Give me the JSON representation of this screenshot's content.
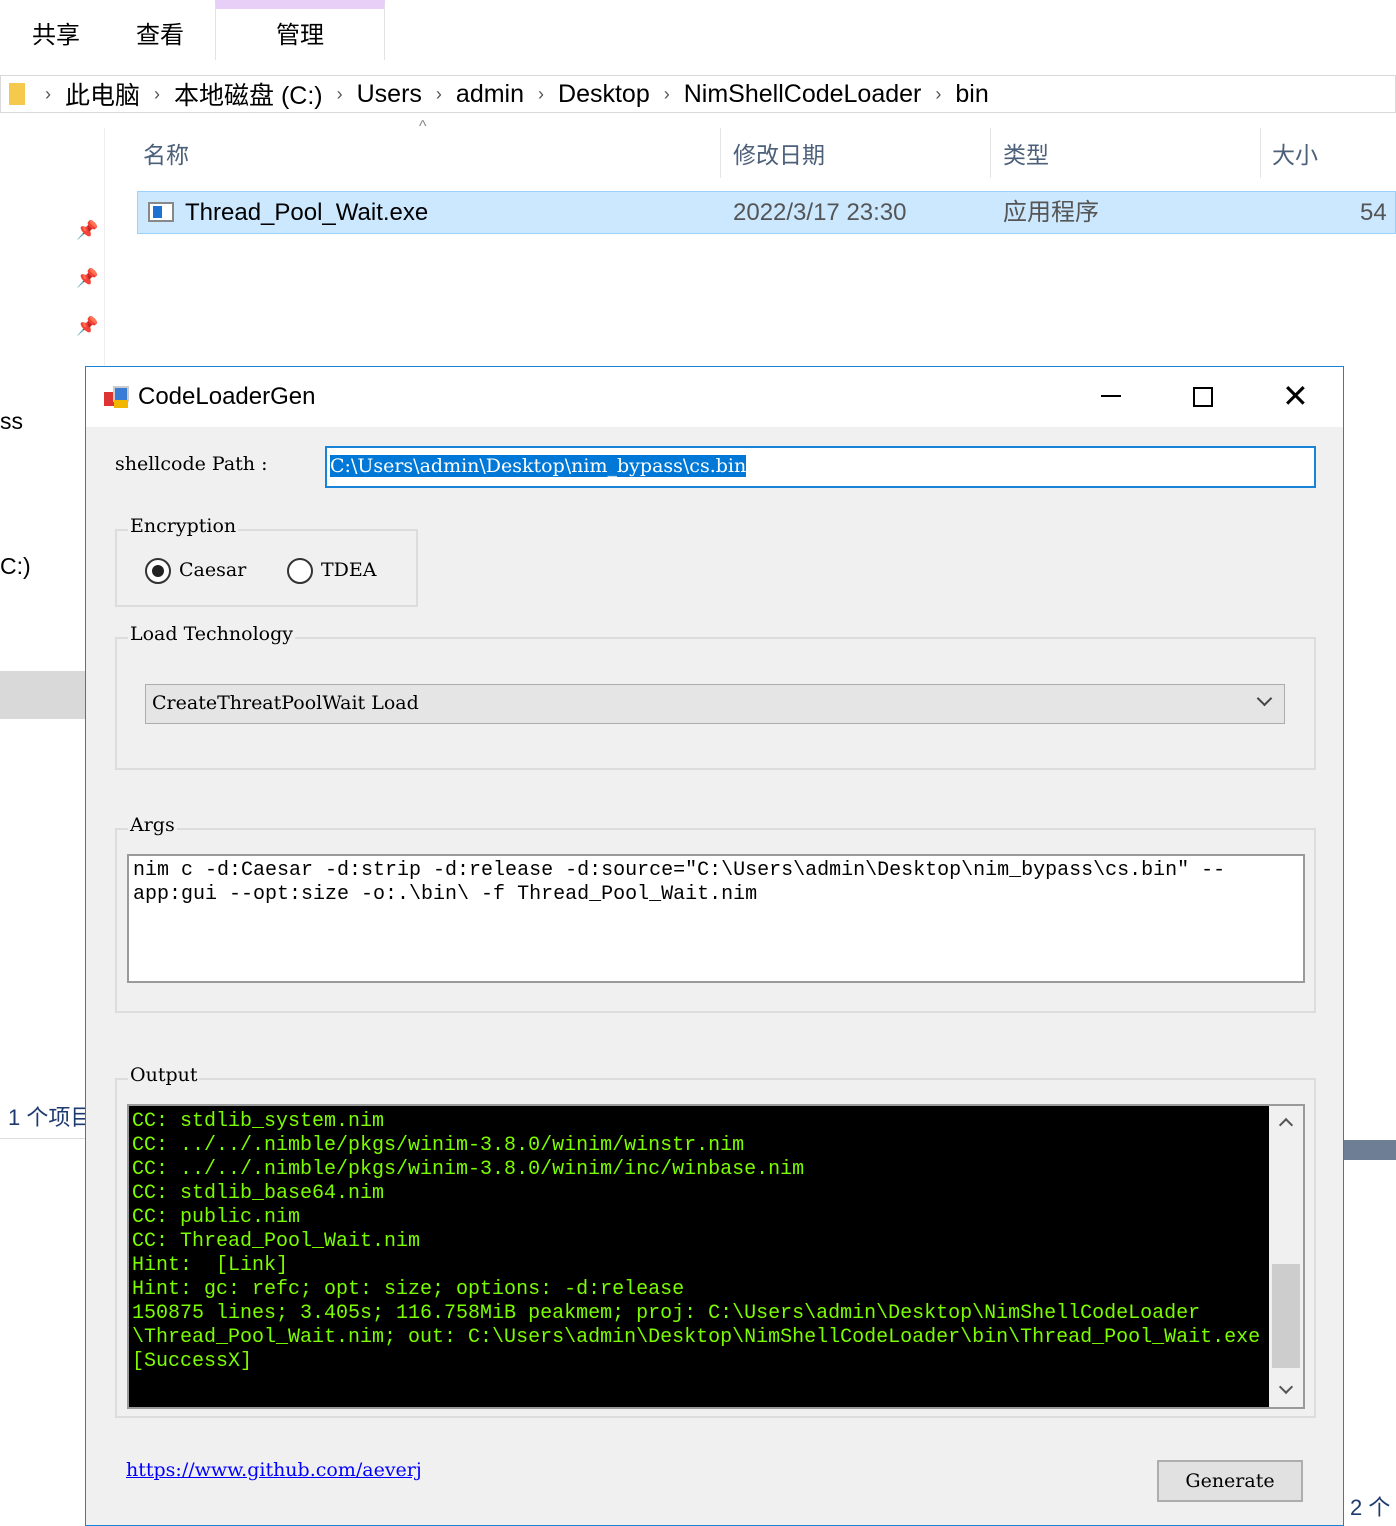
{
  "explorer": {
    "tabs": [
      "共享",
      "查看",
      "管理"
    ],
    "breadcrumb": [
      "此电脑",
      "本地磁盘 (C:)",
      "Users",
      "admin",
      "Desktop",
      "NimShellCodeLoader",
      "bin"
    ],
    "columns": [
      "名称",
      "修改日期",
      "类型",
      "大小"
    ],
    "file": {
      "name": "Thread_Pool_Wait.exe",
      "date": "2022/3/17 23:30",
      "type": "应用程序",
      "size": "54"
    },
    "sidebar_fragments": [
      "ss",
      "C:)"
    ],
    "status_left": "1 个项目",
    "status_right": "2 个"
  },
  "dialog": {
    "title": "CodeLoaderGen",
    "path_label": "shellcode Path :",
    "path_value": "C:\\Users\\admin\\Desktop\\nim_bypass\\cs.bin",
    "encryption": {
      "label": "Encryption",
      "options": [
        "Caesar",
        "TDEA"
      ],
      "selected": "Caesar"
    },
    "load": {
      "label": "Load Technology",
      "selected": "CreateThreatPoolWait Load"
    },
    "args": {
      "label": "Args",
      "lines": [
        "nim c -d:Caesar -d:strip -d:release -d:source=\"C:\\Users\\admin\\Desktop\\nim_bypass\\cs.bin\" --",
        "app:gui --opt:size -o:.\\bin\\ -f Thread_Pool_Wait.nim"
      ]
    },
    "output": {
      "label": "Output",
      "lines": [
        "CC: stdlib_system.nim",
        "CC: ../../.nimble/pkgs/winim-3.8.0/winim/winstr.nim",
        "CC: ../../.nimble/pkgs/winim-3.8.0/winim/inc/winbase.nim",
        "CC: stdlib_base64.nim",
        "CC: public.nim",
        "CC: Thread_Pool_Wait.nim",
        "Hint:  [Link]",
        "Hint: gc: refc; opt: size; options: -d:release",
        "150875 lines; 3.405s; 116.758MiB peakmem; proj: C:\\Users\\admin\\Desktop\\NimShellCodeLoader",
        "\\Thread_Pool_Wait.nim; out: C:\\Users\\admin\\Desktop\\NimShellCodeLoader\\bin\\Thread_Pool_Wait.exe",
        "[SuccessX]"
      ]
    },
    "link": "https://www.github.com/aeverj",
    "generate": "Generate",
    "colors": {
      "output_bg": "#000000",
      "output_fg": "#7cfc00",
      "accent": "#1883d7"
    }
  }
}
